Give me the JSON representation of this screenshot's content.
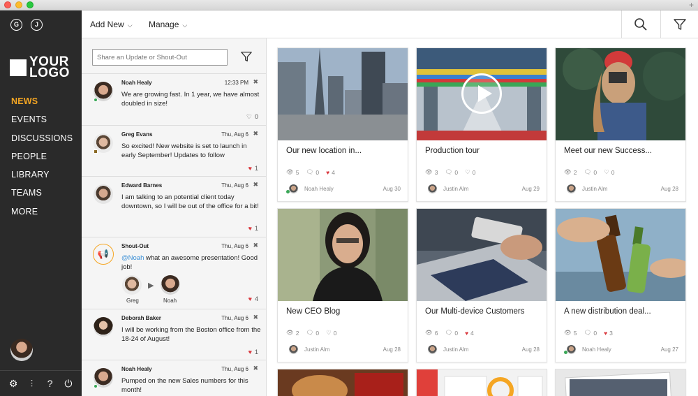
{
  "window": {
    "plus": "+"
  },
  "sidebar": {
    "badges": [
      "G",
      "J"
    ],
    "logo": {
      "line1": "YOUR",
      "line2": "LOGO"
    },
    "nav": [
      {
        "label": "NEWS",
        "active": true
      },
      {
        "label": "EVENTS",
        "active": false
      },
      {
        "label": "DISCUSSIONS",
        "active": false
      },
      {
        "label": "PEOPLE",
        "active": false
      },
      {
        "label": "LIBRARY",
        "active": false
      },
      {
        "label": "TEAMS",
        "active": false
      },
      {
        "label": "MORE",
        "active": false
      }
    ],
    "tools": [
      "settings-icon",
      "sliders-icon",
      "help-icon",
      "power-icon"
    ],
    "tool_glyphs": [
      "⚙",
      "⫶",
      "?",
      "⏻"
    ]
  },
  "topbar": {
    "add_new": "Add New",
    "manage": "Manage",
    "caret": "⌵"
  },
  "feed": {
    "share_placeholder": "Share an Update or Shout-Out",
    "posts": [
      {
        "name": "Noah Healy",
        "time": "12:33 PM",
        "text": "We are growing fast. In 1 year, we have almost doubled in size!",
        "likes": "0",
        "liked": false
      },
      {
        "name": "Greg Evans",
        "time": "Thu, Aug 6",
        "text": "So excited! New website is set to launch in early September! Updates to follow",
        "likes": "1",
        "liked": true
      },
      {
        "name": "Edward Barnes",
        "time": "Thu, Aug 6",
        "text": "I am talking to an potential client today downtown, so I will be out of the office for a bit!",
        "likes": "1",
        "liked": true
      },
      {
        "name": "Shout-Out",
        "time": "Thu, Aug 6",
        "mention": "@Noah",
        "text": " what an awesome presentation! Good job!",
        "likes": "4",
        "liked": true,
        "from": "Greg",
        "to": "Noah"
      },
      {
        "name": "Deborah Baker",
        "time": "Thu, Aug 6",
        "text": "I will be working from the Boston office from the 18-24 of August!",
        "likes": "1",
        "liked": true
      },
      {
        "name": "Noah Healy",
        "time": "Thu, Aug 6",
        "text": "Pumped on the new Sales numbers for this month!",
        "likes": "",
        "liked": false
      }
    ]
  },
  "cards": [
    {
      "title": "Our new location in...",
      "views": "5",
      "comments": "0",
      "likes": "4",
      "liked": true,
      "author": "Noah Healy",
      "date": "Aug 30"
    },
    {
      "title": "Production tour",
      "views": "3",
      "comments": "0",
      "likes": "0",
      "liked": false,
      "author": "Justin Alm",
      "date": "Aug 29",
      "video": true
    },
    {
      "title": "Meet our new Success...",
      "views": "2",
      "comments": "0",
      "likes": "0",
      "liked": false,
      "author": "Justin Alm",
      "date": "Aug 28"
    },
    {
      "title": "New CEO Blog",
      "views": "2",
      "comments": "0",
      "likes": "0",
      "liked": false,
      "author": "Justin Alm",
      "date": "Aug 28"
    },
    {
      "title": "Our Multi-device Customers",
      "views": "6",
      "comments": "0",
      "likes": "4",
      "liked": true,
      "author": "Justin Alm",
      "date": "Aug 28"
    },
    {
      "title": "A new distribution deal...",
      "views": "5",
      "comments": "0",
      "likes": "3",
      "liked": true,
      "author": "Noah Healy",
      "date": "Aug 27"
    }
  ],
  "colors": {
    "accent": "#f5a623",
    "sidebar": "#2a2a2a",
    "heart": "#d9383e",
    "mention": "#3a8fd6",
    "online": "#3aa757"
  }
}
